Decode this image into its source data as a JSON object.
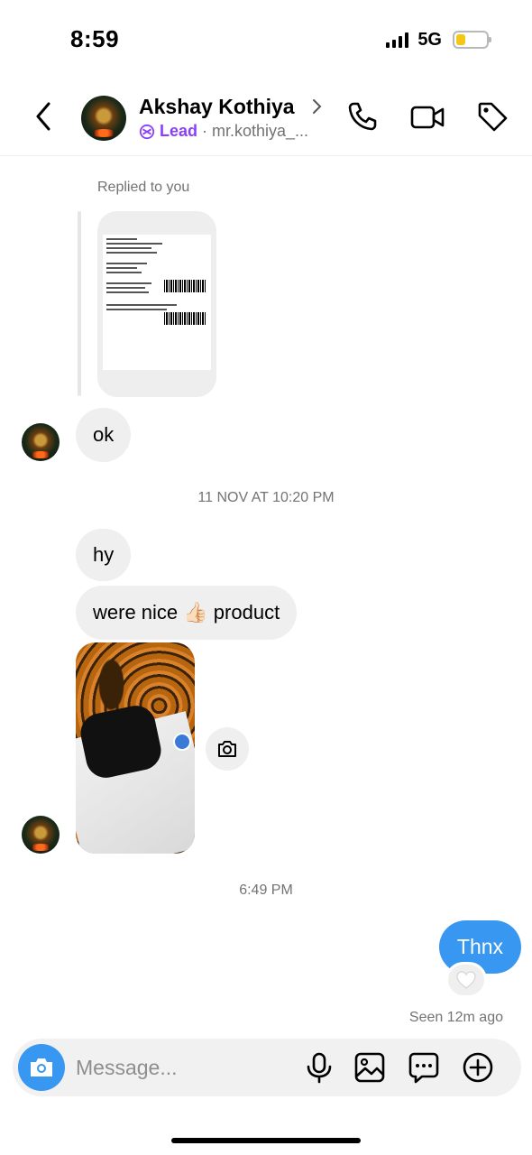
{
  "status_bar": {
    "time": "8:59",
    "network": "5G",
    "battery_level": 0.2,
    "battery_color": "#f5c518"
  },
  "header": {
    "name": "Akshay Kothiya",
    "label": "Lead",
    "separator": "·",
    "username": "mr.kothiya_...",
    "label_color": "#8a3ffc",
    "icons": [
      "back-icon",
      "phone-icon",
      "video-icon",
      "tag-icon"
    ]
  },
  "messages": {
    "replied_label": "Replied to you",
    "ok": "ok",
    "timestamp_1": "11 NOV AT 10:20 PM",
    "hy": "hy",
    "nice_before": "were nice ",
    "emoji": "👍🏻",
    "nice_after": " product",
    "timestamp_2": "6:49 PM",
    "sent_text": "Thnx",
    "reaction": "🤍",
    "seen": "Seen 12m ago",
    "sent_color": "#3897f0"
  },
  "composer": {
    "placeholder": "Message...",
    "icons": [
      "camera-icon",
      "microphone-icon",
      "gallery-icon",
      "sticker-icon",
      "plus-icon"
    ]
  }
}
